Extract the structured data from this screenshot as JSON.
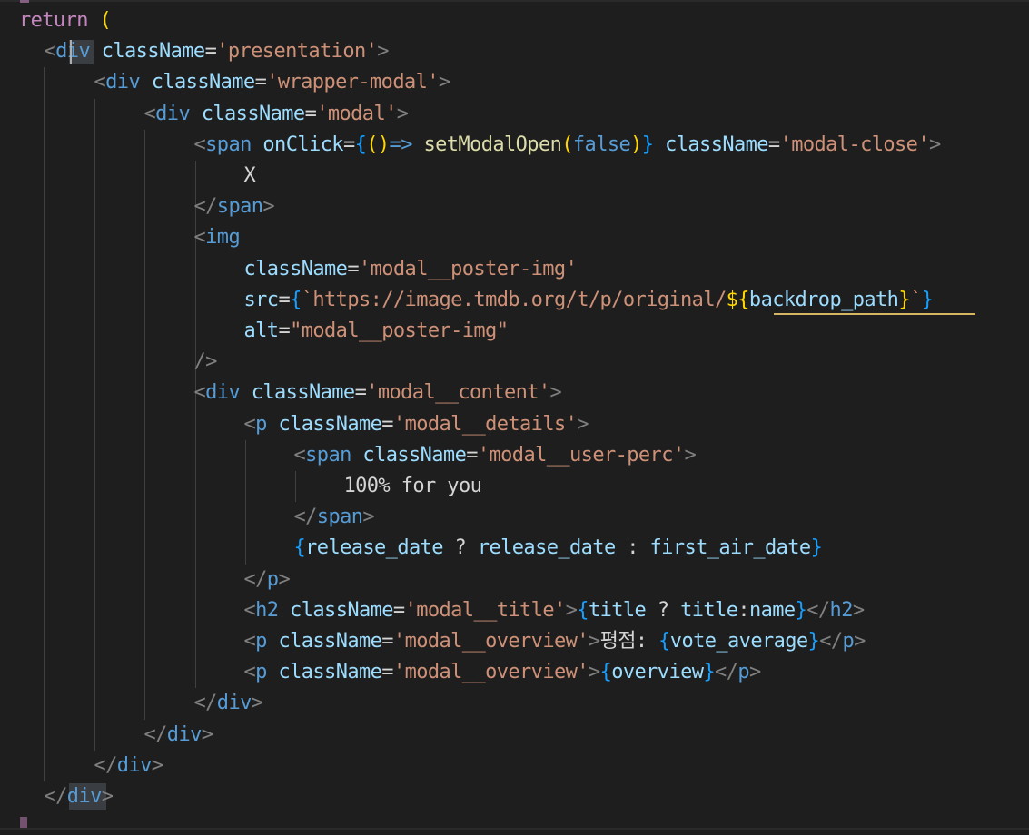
{
  "colors": {
    "background": "#1e1e1e",
    "keyword": "#c586c0",
    "tag": "#569cd6",
    "attribute": "#9cdcfe",
    "string": "#ce9178",
    "function": "#dcdcaa",
    "brace": "#179fff",
    "paren": "#ffd700",
    "punctuation": "#808080",
    "text": "#d4d4d4"
  },
  "code_lines": [
    {
      "indent": 1,
      "tokens": [
        [
          "keyword",
          "return"
        ],
        [
          "text",
          " "
        ],
        [
          "paren",
          "("
        ]
      ]
    },
    {
      "indent": 2,
      "tokens": [
        [
          "punct",
          "<"
        ],
        [
          "tag",
          "div"
        ],
        [
          "text",
          " "
        ],
        [
          "attr",
          "className"
        ],
        [
          "text",
          "="
        ],
        [
          "string",
          "'presentation'"
        ],
        [
          "punct",
          ">"
        ]
      ]
    },
    {
      "indent": 4,
      "tokens": [
        [
          "punct",
          "<"
        ],
        [
          "tag",
          "div"
        ],
        [
          "text",
          " "
        ],
        [
          "attr",
          "className"
        ],
        [
          "text",
          "="
        ],
        [
          "string",
          "'wrapper-modal'"
        ],
        [
          "punct",
          ">"
        ]
      ]
    },
    {
      "indent": 6,
      "tokens": [
        [
          "punct",
          "<"
        ],
        [
          "tag",
          "div"
        ],
        [
          "text",
          " "
        ],
        [
          "attr",
          "className"
        ],
        [
          "text",
          "="
        ],
        [
          "string",
          "'modal'"
        ],
        [
          "punct",
          ">"
        ]
      ]
    },
    {
      "indent": 8,
      "tokens": [
        [
          "punct",
          "<"
        ],
        [
          "tag",
          "span"
        ],
        [
          "text",
          " "
        ],
        [
          "attr",
          "onClick"
        ],
        [
          "text",
          "="
        ],
        [
          "brace",
          "{"
        ],
        [
          "paren",
          "()"
        ],
        [
          "tag",
          "=>"
        ],
        [
          "text",
          " "
        ],
        [
          "func",
          "setModalOpen"
        ],
        [
          "paren",
          "("
        ],
        [
          "tag",
          "false"
        ],
        [
          "paren",
          ")"
        ],
        [
          "brace",
          "}"
        ],
        [
          "text",
          " "
        ],
        [
          "attr",
          "className"
        ],
        [
          "text",
          "="
        ],
        [
          "string",
          "'modal-close'"
        ],
        [
          "punct",
          ">"
        ]
      ]
    },
    {
      "indent": 10,
      "tokens": [
        [
          "text",
          "X"
        ]
      ]
    },
    {
      "indent": 8,
      "tokens": [
        [
          "punct",
          "</"
        ],
        [
          "tag",
          "span"
        ],
        [
          "punct",
          ">"
        ]
      ]
    },
    {
      "indent": 8,
      "tokens": [
        [
          "punct",
          "<"
        ],
        [
          "tag",
          "img"
        ]
      ]
    },
    {
      "indent": 10,
      "tokens": [
        [
          "attr",
          "className"
        ],
        [
          "text",
          "="
        ],
        [
          "string",
          "'modal__poster-img'"
        ]
      ]
    },
    {
      "indent": 10,
      "tokens": [
        [
          "attr",
          "src"
        ],
        [
          "text",
          "="
        ],
        [
          "brace",
          "{"
        ],
        [
          "string",
          "`https://image.tmdb.org/t/p/original/"
        ],
        [
          "paren",
          "${"
        ],
        [
          "attr",
          "backdrop_path"
        ],
        [
          "paren",
          "}"
        ],
        [
          "string",
          "`"
        ],
        [
          "brace",
          "}"
        ]
      ]
    },
    {
      "indent": 10,
      "tokens": [
        [
          "attr",
          "alt"
        ],
        [
          "text",
          "="
        ],
        [
          "string",
          "\"modal__poster-img\""
        ]
      ]
    },
    {
      "indent": 8,
      "tokens": [
        [
          "punct",
          "/>"
        ]
      ]
    },
    {
      "indent": 8,
      "tokens": [
        [
          "punct",
          "<"
        ],
        [
          "tag",
          "div"
        ],
        [
          "text",
          " "
        ],
        [
          "attr",
          "className"
        ],
        [
          "text",
          "="
        ],
        [
          "string",
          "'modal__content'"
        ],
        [
          "punct",
          ">"
        ]
      ]
    },
    {
      "indent": 10,
      "tokens": [
        [
          "punct",
          "<"
        ],
        [
          "tag",
          "p"
        ],
        [
          "text",
          " "
        ],
        [
          "attr",
          "className"
        ],
        [
          "text",
          "="
        ],
        [
          "string",
          "'modal__details'"
        ],
        [
          "punct",
          ">"
        ]
      ]
    },
    {
      "indent": 12,
      "tokens": [
        [
          "punct",
          "<"
        ],
        [
          "tag",
          "span"
        ],
        [
          "text",
          " "
        ],
        [
          "attr",
          "className"
        ],
        [
          "text",
          "="
        ],
        [
          "string",
          "'modal__user-perc'"
        ],
        [
          "punct",
          ">"
        ]
      ]
    },
    {
      "indent": 14,
      "tokens": [
        [
          "text",
          "100% for you"
        ]
      ]
    },
    {
      "indent": 12,
      "tokens": [
        [
          "punct",
          "</"
        ],
        [
          "tag",
          "span"
        ],
        [
          "punct",
          ">"
        ]
      ]
    },
    {
      "indent": 12,
      "tokens": [
        [
          "brace",
          "{"
        ],
        [
          "attr",
          "release_date"
        ],
        [
          "text",
          " ? "
        ],
        [
          "attr",
          "release_date"
        ],
        [
          "text",
          " : "
        ],
        [
          "attr",
          "first_air_date"
        ],
        [
          "brace",
          "}"
        ]
      ]
    },
    {
      "indent": 10,
      "tokens": [
        [
          "punct",
          "</"
        ],
        [
          "tag",
          "p"
        ],
        [
          "punct",
          ">"
        ]
      ]
    },
    {
      "indent": 10,
      "tokens": [
        [
          "punct",
          "<"
        ],
        [
          "tag",
          "h2"
        ],
        [
          "text",
          " "
        ],
        [
          "attr",
          "className"
        ],
        [
          "text",
          "="
        ],
        [
          "string",
          "'modal__title'"
        ],
        [
          "punct",
          ">"
        ],
        [
          "brace",
          "{"
        ],
        [
          "attr",
          "title"
        ],
        [
          "text",
          " ? "
        ],
        [
          "attr",
          "title"
        ],
        [
          "text",
          ":"
        ],
        [
          "attr",
          "name"
        ],
        [
          "brace",
          "}"
        ],
        [
          "punct",
          "</"
        ],
        [
          "tag",
          "h2"
        ],
        [
          "punct",
          ">"
        ]
      ]
    },
    {
      "indent": 10,
      "tokens": [
        [
          "punct",
          "<"
        ],
        [
          "tag",
          "p"
        ],
        [
          "text",
          " "
        ],
        [
          "attr",
          "className"
        ],
        [
          "text",
          "="
        ],
        [
          "string",
          "'modal__overview'"
        ],
        [
          "punct",
          ">"
        ],
        [
          "text",
          "평점: "
        ],
        [
          "brace",
          "{"
        ],
        [
          "attr",
          "vote_average"
        ],
        [
          "brace",
          "}"
        ],
        [
          "punct",
          "</"
        ],
        [
          "tag",
          "p"
        ],
        [
          "punct",
          ">"
        ]
      ]
    },
    {
      "indent": 10,
      "tokens": [
        [
          "punct",
          "<"
        ],
        [
          "tag",
          "p"
        ],
        [
          "text",
          " "
        ],
        [
          "attr",
          "className"
        ],
        [
          "text",
          "="
        ],
        [
          "string",
          "'modal__overview'"
        ],
        [
          "punct",
          ">"
        ],
        [
          "brace",
          "{"
        ],
        [
          "attr",
          "overview"
        ],
        [
          "brace",
          "}"
        ],
        [
          "punct",
          "</"
        ],
        [
          "tag",
          "p"
        ],
        [
          "punct",
          ">"
        ]
      ]
    },
    {
      "indent": 8,
      "tokens": [
        [
          "punct",
          "</"
        ],
        [
          "tag",
          "div"
        ],
        [
          "punct",
          ">"
        ]
      ]
    },
    {
      "indent": 6,
      "tokens": [
        [
          "punct",
          "</"
        ],
        [
          "tag",
          "div"
        ],
        [
          "punct",
          ">"
        ]
      ]
    },
    {
      "indent": 4,
      "tokens": [
        [
          "punct",
          "</"
        ],
        [
          "tag",
          "div"
        ],
        [
          "punct",
          ">"
        ]
      ]
    },
    {
      "indent": 2,
      "tokens": [
        [
          "punct",
          "</"
        ],
        [
          "tag",
          "div"
        ],
        [
          "punct",
          ">"
        ]
      ]
    }
  ]
}
